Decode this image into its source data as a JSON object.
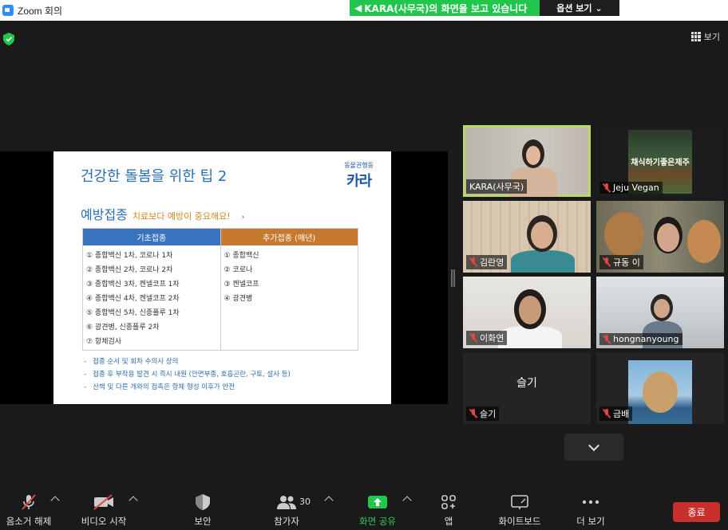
{
  "window": {
    "title": "Zoom 회의"
  },
  "banner": {
    "message": "KARA(사무국)의 화면을 보고 있습니다",
    "options_label": "옵션 보기"
  },
  "view": {
    "label": "보기"
  },
  "slide": {
    "title": "건강한 돌봄을 위한 팁 2",
    "org_small": "동물권행동",
    "org_big": "카라",
    "subtitle": "예방접종",
    "subtitle_note": "치료보다 예방이 중요해요!",
    "columns": [
      {
        "header": "기초접종",
        "items": [
          "① 종합백신 1차, 코로나 1차",
          "② 종합백신 2차, 코로나 2차",
          "③ 종합백신 3차, 켄넬코프 1차",
          "④ 종합백신 4차, 켄넬코프 2차",
          "⑤ 종합백신 5차, 신종플루 1차",
          "⑥ 광견병, 신종플루 2차",
          "⑦ 항체검사"
        ]
      },
      {
        "header": "추가접종 (매년)",
        "items": [
          "① 종합백신",
          "② 코로나",
          "③ 켄넬코프",
          "④ 광견병"
        ]
      }
    ],
    "notes": [
      "접종 순서 및 회차 수의사 상의",
      "접종 후 부작용 발견 시 즉시 내원 (안면부종, 호흡곤란, 구토, 설사 등)",
      "산책 및 다른 개와의 접촉은 항체 형성 이후가 안전"
    ]
  },
  "participants": [
    {
      "name": "KARA(사무국)",
      "muted": false,
      "active": true
    },
    {
      "name": "Jeju Vegan",
      "muted": true,
      "active": false,
      "banner_text": "채식하기좋은제주"
    },
    {
      "name": "김란영",
      "muted": true,
      "active": false
    },
    {
      "name": "규동 이",
      "muted": true,
      "active": false
    },
    {
      "name": "이화연",
      "muted": true,
      "active": false
    },
    {
      "name": "hongnanyoung",
      "muted": true,
      "active": false
    },
    {
      "name": "슬기",
      "muted": true,
      "active": false,
      "video_off": true
    },
    {
      "name": "금배",
      "muted": true,
      "active": false
    }
  ],
  "toolbar": {
    "unmute": "음소거 해제",
    "video": "비디오 시작",
    "security": "보안",
    "participants": "참가자",
    "participants_count": "30",
    "share": "화면 공유",
    "apps": "앱",
    "whiteboard": "화이트보드",
    "more": "더 보기",
    "end": "종료"
  },
  "colors": {
    "share_green": "#23c64d",
    "end_red": "#c9302c",
    "active_speaker": "#b9d86a"
  }
}
